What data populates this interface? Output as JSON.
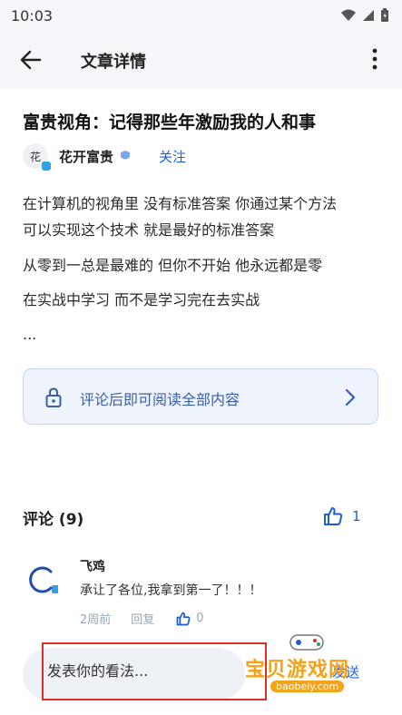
{
  "status": {
    "time": "10:03"
  },
  "appbar": {
    "title": "文章详情"
  },
  "article": {
    "title": "富贵视角：记得那些年激励我的人和事",
    "author": {
      "avatar_char": "花",
      "name": "花开富贵",
      "follow_label": "关注"
    },
    "paragraphs": [
      "在计算机的视角里 没有标准答案 你通过某个方法",
      "可以实现这个技术 就是最好的标准答案",
      "从零到一总是最难的 但你不开始 他永远都是零",
      "在实战中学习 而不是学习完在去实战",
      "..."
    ]
  },
  "unlock": {
    "label": "评论后即可阅读全部内容"
  },
  "comments": {
    "heading": "评论 (9)",
    "like_count": "1",
    "items": [
      {
        "name": "飞鸡",
        "text": "承让了各位,我拿到第一了！！！",
        "time": "2周前",
        "reply_label": "回复",
        "likes": "0"
      }
    ]
  },
  "composer": {
    "placeholder": "发表你的看法...",
    "send_label": "发送"
  },
  "watermark": {
    "title": "宝贝游戏网",
    "url": "baobeiy.com"
  },
  "colors": {
    "accent": "#1f5fd6",
    "highlight_border": "#d9302c",
    "watermark": "#f3a21a"
  }
}
